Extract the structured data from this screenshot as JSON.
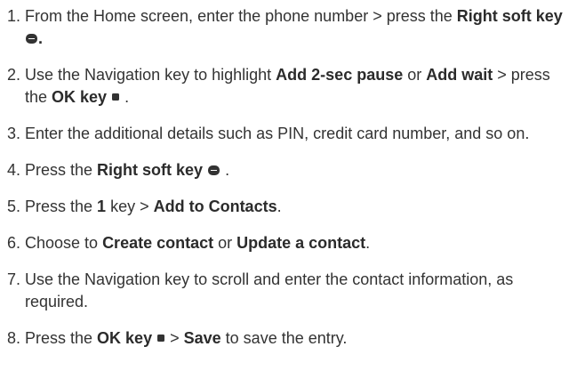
{
  "steps": [
    {
      "num": "1.",
      "parts": [
        {
          "t": "text",
          "v": "From the Home screen, enter the phone number > press the "
        },
        {
          "t": "bold",
          "v": "Right soft key"
        },
        {
          "t": "text",
          "v": " "
        },
        {
          "t": "icon",
          "icon": "softkey-icon"
        },
        {
          "t": "bold",
          "v": "."
        }
      ]
    },
    {
      "num": "2.",
      "parts": [
        {
          "t": "text",
          "v": "Use the Navigation  key to highlight "
        },
        {
          "t": "bold",
          "v": "Add 2-sec pause"
        },
        {
          "t": "text",
          "v": " or "
        },
        {
          "t": "bold",
          "v": "Add wait"
        },
        {
          "t": "text",
          "v": " > press the "
        },
        {
          "t": "bold",
          "v": "OK key"
        },
        {
          "t": "text",
          "v": " "
        },
        {
          "t": "icon",
          "icon": "ok-key-icon"
        },
        {
          "t": "text",
          "v": " ."
        }
      ]
    },
    {
      "num": "3.",
      "parts": [
        {
          "t": "text",
          "v": "Enter the additional details such as PIN, credit card number, and so on."
        }
      ]
    },
    {
      "num": "4.",
      "parts": [
        {
          "t": "text",
          "v": "Press the "
        },
        {
          "t": "bold",
          "v": "Right soft  key"
        },
        {
          "t": "text",
          "v": " "
        },
        {
          "t": "icon",
          "icon": "softkey-icon"
        },
        {
          "t": "text",
          "v": " ."
        }
      ]
    },
    {
      "num": "5.",
      "parts": [
        {
          "t": "text",
          "v": "Press the "
        },
        {
          "t": "bold",
          "v": "1"
        },
        {
          "t": "text",
          "v": " key > "
        },
        {
          "t": "bold",
          "v": "Add to Contacts"
        },
        {
          "t": "text",
          "v": "."
        }
      ]
    },
    {
      "num": "6.",
      "parts": [
        {
          "t": "text",
          "v": "Choose to "
        },
        {
          "t": "bold",
          "v": "Create contact"
        },
        {
          "t": "text",
          "v": " or "
        },
        {
          "t": "bold",
          "v": "Update a contact"
        },
        {
          "t": "text",
          "v": "."
        }
      ]
    },
    {
      "num": "7.",
      "parts": [
        {
          "t": "text",
          "v": "Use the Navigation   key to scroll and enter the contact information, as required."
        }
      ]
    },
    {
      "num": "8.",
      "parts": [
        {
          "t": "text",
          "v": "Press the "
        },
        {
          "t": "bold",
          "v": "OK key"
        },
        {
          "t": "text",
          "v": " "
        },
        {
          "t": "icon",
          "icon": "ok-key-icon"
        },
        {
          "t": "text",
          "v": " > "
        },
        {
          "t": "bold",
          "v": "Save"
        },
        {
          "t": "text",
          "v": " to save the entry."
        }
      ]
    }
  ]
}
